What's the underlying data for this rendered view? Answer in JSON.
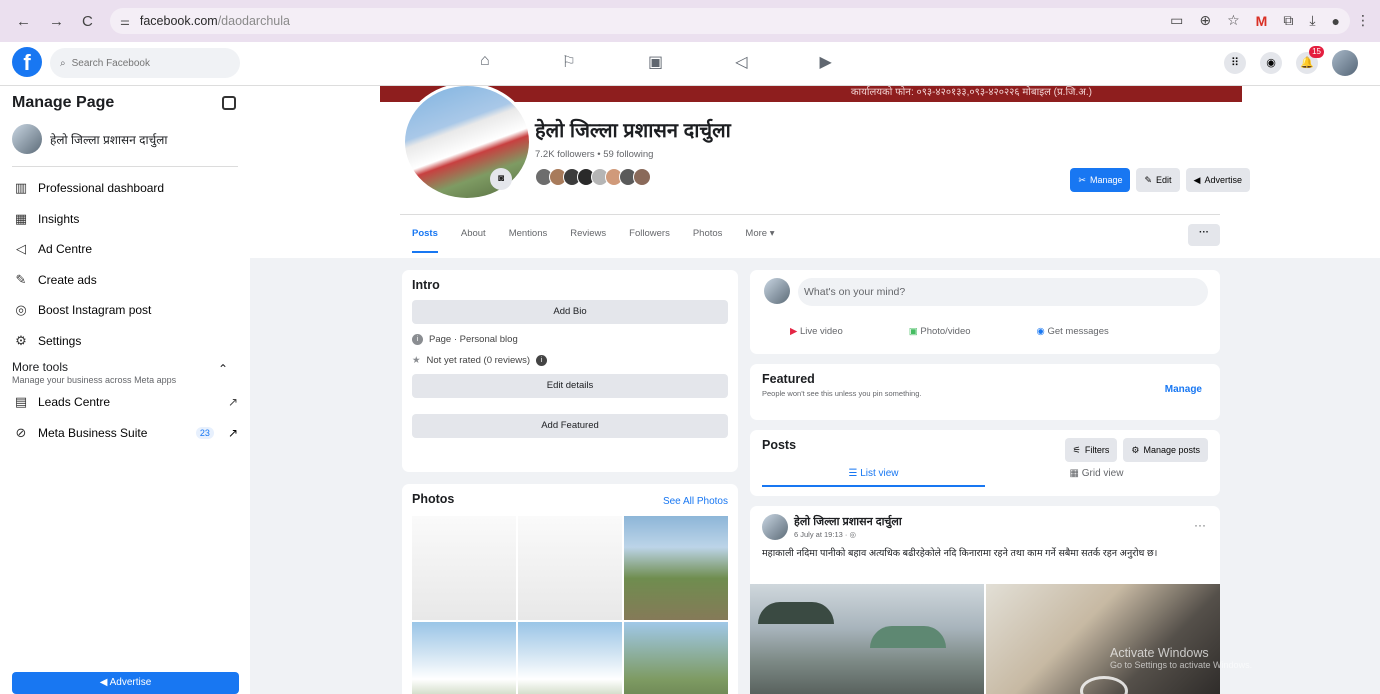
{
  "browser": {
    "url_domain": "facebook.com",
    "url_path": "/daodarchula",
    "nav": [
      "←",
      "→",
      "C"
    ],
    "icons": [
      "screen-icon",
      "zoom-icon",
      "star-icon",
      "gmail-icon",
      "extensions-icon",
      "download-icon",
      "profile-icon",
      "menu-icon"
    ]
  },
  "fb": {
    "search_placeholder": "Search Facebook",
    "notif_count": "15"
  },
  "sidebar": {
    "title": "Manage Page",
    "page_name": "हेलो जिल्ला प्रशासन दार्चुला",
    "items": [
      {
        "label": "Professional dashboard",
        "icon": "dashboard-icon",
        "glyph": "▥"
      },
      {
        "label": "Insights",
        "icon": "insights-icon",
        "glyph": "▦"
      },
      {
        "label": "Ad Centre",
        "icon": "megaphone-icon",
        "glyph": "📣"
      },
      {
        "label": "Create ads",
        "icon": "pencil-icon",
        "glyph": "✎"
      },
      {
        "label": "Boost Instagram post",
        "icon": "instagram-icon",
        "glyph": "◎"
      },
      {
        "label": "Settings",
        "icon": "gear-icon",
        "glyph": "⚙"
      }
    ],
    "more_tools": "More tools",
    "more_tools_sub": "Manage your business across Meta apps",
    "leads": "Leads Centre",
    "meta_suite": "Meta Business Suite",
    "meta_badge": "23",
    "advertise": "Advertise"
  },
  "profile": {
    "name": "हेलो जिल्ला प्रशासन दार्चुला",
    "stats": "7.2K followers • 59 following",
    "manage": "Manage",
    "edit": "Edit",
    "advertise": "Advertise",
    "cover_text": "कार्यालयको फोन: ०९३-४२०१३३,०९३-४२०२२६ मोबाइल (प्र.जि.अ.)"
  },
  "tabs": [
    "Posts",
    "About",
    "Mentions",
    "Reviews",
    "Followers",
    "Photos",
    "More ▾"
  ],
  "intro": {
    "title": "Intro",
    "add_bio": "Add Bio",
    "page_type": "Page · Personal blog",
    "rating": "Not yet rated (0 reviews)",
    "edit_details": "Edit details",
    "add_featured": "Add Featured"
  },
  "photos": {
    "title": "Photos",
    "see_all": "See All Photos"
  },
  "create": {
    "placeholder": "What's on your mind?",
    "live": "Live video",
    "photo": "Photo/video",
    "messages": "Get messages"
  },
  "featured": {
    "title": "Featured",
    "sub": "People won't see this unless you pin something.",
    "manage": "Manage"
  },
  "posts_section": {
    "title": "Posts",
    "filters": "Filters",
    "manage_posts": "Manage posts",
    "list_view": "List view",
    "grid_view": "Grid view"
  },
  "post": {
    "author": "हेलो जिल्ला प्रशासन दार्चुला",
    "date": "6 July at 19:13 · ◎",
    "text": "महाकाली नदिमा पानीको बहाव अत्यधिक बढीरहेकोले नदि किनारामा रहने तथा काम गर्ने सबैमा सतर्क रहन अनुरोध छ।"
  },
  "watermark": {
    "title": "Activate Windows",
    "sub": "Go to Settings to activate Windows."
  },
  "colors": {
    "accent": "#1877f2",
    "cover": "#8e1e1e"
  }
}
